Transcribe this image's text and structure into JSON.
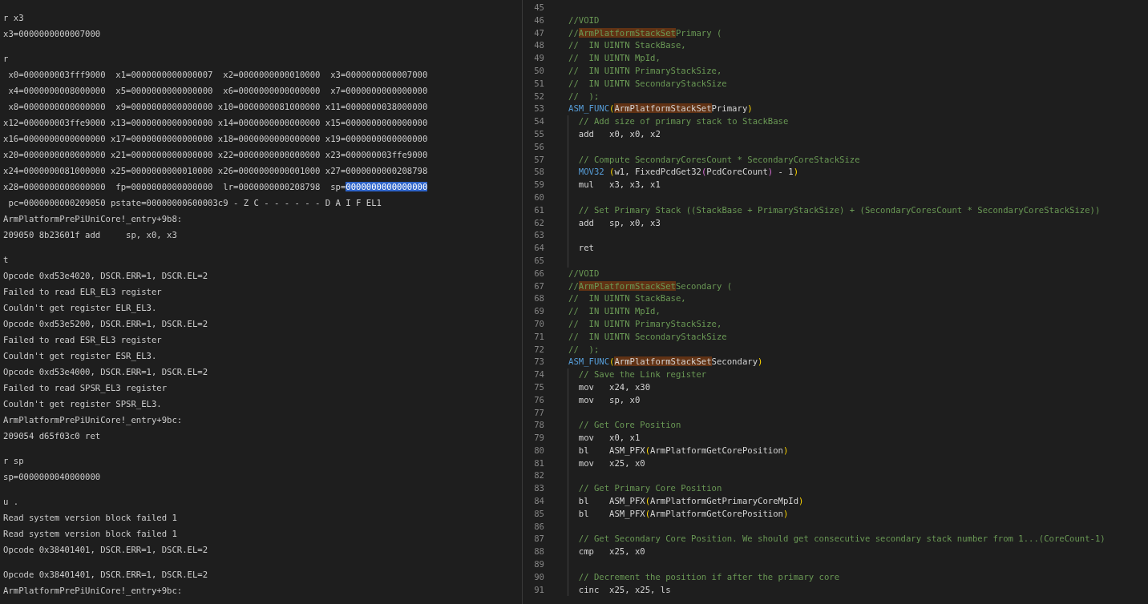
{
  "console": {
    "blocks": [
      {
        "lines": [
          "r x3",
          "x3=0000000000007000"
        ]
      },
      {
        "lines": [
          "r",
          " x0=000000003fff9000  x1=0000000000000007  x2=0000000000010000  x3=0000000000007000",
          " x4=0000000008000000  x5=0000000000000000  x6=0000000000000000  x7=0000000000000000",
          " x8=0000000000000000  x9=0000000000000000 x10=0000000081000000 x11=0000000038000000",
          "x12=000000003ffe9000 x13=0000000000000000 x14=0000000000000000 x15=0000000000000000",
          "x16=0000000000000000 x17=0000000000000000 x18=0000000000000000 x19=0000000000000000",
          "x20=0000000000000000 x21=0000000000000000 x22=0000000000000000 x23=000000003ffe9000",
          "x24=0000000081000000 x25=0000000000010000 x26=0000000000001000 x27=0000000000208798",
          {
            "text": "x28=0000000000000000  fp=0000000000000000  lr=0000000000208798  sp=",
            "selection": "0000000000000000"
          },
          " pc=0000000000209050 pstate=00000000600003c9 - Z C - - - - - - D A I F EL1",
          "ArmPlatformPrePiUniCore!_entry+9b8:",
          "209050 8b23601f add     sp, x0, x3"
        ]
      },
      {
        "lines": [
          "t",
          "Opcode 0xd53e4020, DSCR.ERR=1, DSCR.EL=2",
          "Failed to read ELR_EL3 register",
          "Couldn't get register ELR_EL3.",
          "Opcode 0xd53e5200, DSCR.ERR=1, DSCR.EL=2",
          "Failed to read ESR_EL3 register",
          "Couldn't get register ESR_EL3.",
          "Opcode 0xd53e4000, DSCR.ERR=1, DSCR.EL=2",
          "Failed to read SPSR_EL3 register",
          "Couldn't get register SPSR_EL3.",
          "ArmPlatformPrePiUniCore!_entry+9bc:",
          "209054 d65f03c0 ret"
        ]
      },
      {
        "lines": [
          "r sp",
          "sp=0000000040000000"
        ]
      },
      {
        "lines": [
          "u .",
          "Read system version block failed 1",
          "Read system version block failed 1",
          "Opcode 0x38401401, DSCR.ERR=1, DSCR.EL=2"
        ]
      },
      {
        "lines": [
          "Opcode 0x38401401, DSCR.ERR=1, DSCR.EL=2",
          "ArmPlatformPrePiUniCore!_entry+9bc:"
        ]
      }
    ]
  },
  "editor": {
    "lines": [
      {
        "n": "45",
        "guide": false
      },
      {
        "n": "46",
        "guide": false,
        "tokens": [
          {
            "kind": "comment",
            "text": "//VOID"
          }
        ]
      },
      {
        "n": "47",
        "guide": false,
        "tokens": [
          {
            "kind": "comment",
            "text": "//"
          },
          {
            "kind": "comment",
            "text": "ArmPlatformStackSet",
            "match": true
          },
          {
            "kind": "comment",
            "text": "Primary ("
          }
        ]
      },
      {
        "n": "48",
        "guide": false,
        "tokens": [
          {
            "kind": "comment",
            "text": "//  IN UINTN StackBase,"
          }
        ]
      },
      {
        "n": "49",
        "guide": false,
        "tokens": [
          {
            "kind": "comment",
            "text": "//  IN UINTN MpId,"
          }
        ]
      },
      {
        "n": "50",
        "guide": false,
        "tokens": [
          {
            "kind": "comment",
            "text": "//  IN UINTN PrimaryStackSize,"
          }
        ]
      },
      {
        "n": "51",
        "guide": false,
        "tokens": [
          {
            "kind": "comment",
            "text": "//  IN UINTN SecondaryStackSize"
          }
        ]
      },
      {
        "n": "52",
        "guide": false,
        "tokens": [
          {
            "kind": "comment",
            "text": "//  );"
          }
        ]
      },
      {
        "n": "53",
        "guide": false,
        "tokens": [
          {
            "kind": "macro",
            "text": "ASM_FUNC"
          },
          {
            "kind": "bracket",
            "text": "("
          },
          {
            "kind": "plain",
            "text": "ArmPlatformStackSet",
            "match": true
          },
          {
            "kind": "plain",
            "text": "Primary"
          },
          {
            "kind": "bracket",
            "text": ")"
          }
        ]
      },
      {
        "n": "54",
        "guide": true,
        "tokens": [
          {
            "kind": "comment",
            "text": "// Add size of primary stack to StackBase"
          }
        ]
      },
      {
        "n": "55",
        "guide": true,
        "tokens": [
          {
            "kind": "plain",
            "text": "add   x0, x0, x2"
          }
        ]
      },
      {
        "n": "56",
        "guide": true
      },
      {
        "n": "57",
        "guide": true,
        "tokens": [
          {
            "kind": "comment",
            "text": "// Compute SecondaryCoresCount * SecondaryCoreStackSize"
          }
        ]
      },
      {
        "n": "58",
        "guide": true,
        "tokens": [
          {
            "kind": "macro",
            "text": "MOV32 "
          },
          {
            "kind": "bracket",
            "text": "("
          },
          {
            "kind": "plain",
            "text": "w1, FixedPcdGet32"
          },
          {
            "kind": "bracket2",
            "text": "("
          },
          {
            "kind": "plain",
            "text": "PcdCoreCount"
          },
          {
            "kind": "bracket2",
            "text": ")"
          },
          {
            "kind": "plain",
            "text": " - 1"
          },
          {
            "kind": "bracket",
            "text": ")"
          }
        ]
      },
      {
        "n": "59",
        "guide": true,
        "tokens": [
          {
            "kind": "plain",
            "text": "mul   x3, x3, x1"
          }
        ]
      },
      {
        "n": "60",
        "guide": true
      },
      {
        "n": "61",
        "guide": true,
        "tokens": [
          {
            "kind": "comment",
            "text": "// Set Primary Stack ((StackBase + PrimaryStackSize) + (SecondaryCoresCount * SecondaryCoreStackSize))"
          }
        ]
      },
      {
        "n": "62",
        "guide": true,
        "tokens": [
          {
            "kind": "plain",
            "text": "add   sp, x0, x3"
          }
        ]
      },
      {
        "n": "63",
        "guide": true
      },
      {
        "n": "64",
        "guide": true,
        "tokens": [
          {
            "kind": "plain",
            "text": "ret"
          }
        ]
      },
      {
        "n": "65",
        "guide": true
      },
      {
        "n": "66",
        "guide": false,
        "tokens": [
          {
            "kind": "comment",
            "text": "//VOID"
          }
        ]
      },
      {
        "n": "67",
        "guide": false,
        "tokens": [
          {
            "kind": "comment",
            "text": "//"
          },
          {
            "kind": "comment",
            "text": "ArmPlatformStackSet",
            "match": true
          },
          {
            "kind": "comment",
            "text": "Secondary ("
          }
        ]
      },
      {
        "n": "68",
        "guide": false,
        "tokens": [
          {
            "kind": "comment",
            "text": "//  IN UINTN StackBase,"
          }
        ]
      },
      {
        "n": "69",
        "guide": false,
        "tokens": [
          {
            "kind": "comment",
            "text": "//  IN UINTN MpId,"
          }
        ]
      },
      {
        "n": "70",
        "guide": false,
        "tokens": [
          {
            "kind": "comment",
            "text": "//  IN UINTN PrimaryStackSize,"
          }
        ]
      },
      {
        "n": "71",
        "guide": false,
        "tokens": [
          {
            "kind": "comment",
            "text": "//  IN UINTN SecondaryStackSize"
          }
        ]
      },
      {
        "n": "72",
        "guide": false,
        "tokens": [
          {
            "kind": "comment",
            "text": "//  );"
          }
        ]
      },
      {
        "n": "73",
        "guide": false,
        "tokens": [
          {
            "kind": "macro",
            "text": "ASM_FUNC"
          },
          {
            "kind": "bracket",
            "text": "("
          },
          {
            "kind": "plain",
            "text": "ArmPlatformStackSet",
            "match": true
          },
          {
            "kind": "plain",
            "text": "Secondary"
          },
          {
            "kind": "bracket",
            "text": ")"
          }
        ]
      },
      {
        "n": "74",
        "guide": true,
        "tokens": [
          {
            "kind": "comment",
            "text": "// Save the Link register"
          }
        ]
      },
      {
        "n": "75",
        "guide": true,
        "tokens": [
          {
            "kind": "plain",
            "text": "mov   x24, x30"
          }
        ]
      },
      {
        "n": "76",
        "guide": true,
        "tokens": [
          {
            "kind": "plain",
            "text": "mov   sp, x0"
          }
        ]
      },
      {
        "n": "77",
        "guide": true
      },
      {
        "n": "78",
        "guide": true,
        "tokens": [
          {
            "kind": "comment",
            "text": "// Get Core Position"
          }
        ]
      },
      {
        "n": "79",
        "guide": true,
        "tokens": [
          {
            "kind": "plain",
            "text": "mov   x0, x1"
          }
        ]
      },
      {
        "n": "80",
        "guide": true,
        "tokens": [
          {
            "kind": "plain",
            "text": "bl    ASM_PFX"
          },
          {
            "kind": "bracket",
            "text": "("
          },
          {
            "kind": "plain",
            "text": "ArmPlatformGetCorePosition"
          },
          {
            "kind": "bracket",
            "text": ")"
          }
        ]
      },
      {
        "n": "81",
        "guide": true,
        "tokens": [
          {
            "kind": "plain",
            "text": "mov   x25, x0"
          }
        ]
      },
      {
        "n": "82",
        "guide": true
      },
      {
        "n": "83",
        "guide": true,
        "tokens": [
          {
            "kind": "comment",
            "text": "// Get Primary Core Position"
          }
        ]
      },
      {
        "n": "84",
        "guide": true,
        "tokens": [
          {
            "kind": "plain",
            "text": "bl    ASM_PFX"
          },
          {
            "kind": "bracket",
            "text": "("
          },
          {
            "kind": "plain",
            "text": "ArmPlatformGetPrimaryCoreMpId"
          },
          {
            "kind": "bracket",
            "text": ")"
          }
        ]
      },
      {
        "n": "85",
        "guide": true,
        "tokens": [
          {
            "kind": "plain",
            "text": "bl    ASM_PFX"
          },
          {
            "kind": "bracket",
            "text": "("
          },
          {
            "kind": "plain",
            "text": "ArmPlatformGetCorePosition"
          },
          {
            "kind": "bracket",
            "text": ")"
          }
        ]
      },
      {
        "n": "86",
        "guide": true
      },
      {
        "n": "87",
        "guide": true,
        "tokens": [
          {
            "kind": "comment",
            "text": "// Get Secondary Core Position. We should get consecutive secondary stack number from 1...(CoreCount-1)"
          }
        ]
      },
      {
        "n": "88",
        "guide": true,
        "tokens": [
          {
            "kind": "plain",
            "text": "cmp   x25, x0"
          }
        ]
      },
      {
        "n": "89",
        "guide": true
      },
      {
        "n": "90",
        "guide": true,
        "tokens": [
          {
            "kind": "comment",
            "text": "// Decrement the position if after the primary core"
          }
        ]
      },
      {
        "n": "91",
        "guide": true,
        "tokens": [
          {
            "kind": "plain",
            "text": "cinc  x25, x25, ls"
          }
        ]
      }
    ]
  }
}
